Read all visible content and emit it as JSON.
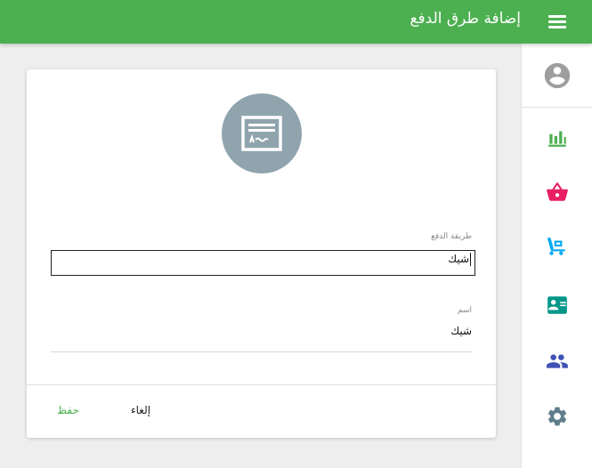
{
  "header": {
    "title": "إضافة طرق الدفع",
    "menu_icon": "menu-icon"
  },
  "sidebar": {
    "items": [
      {
        "name": "profile",
        "icon": "account-circle-icon",
        "color": "#9e9e9e"
      },
      {
        "name": "reports",
        "icon": "bar-chart-icon",
        "color": "#4caf50"
      },
      {
        "name": "sales",
        "icon": "shopping-basket-icon",
        "color": "#e91e63"
      },
      {
        "name": "purchases",
        "icon": "dolly-cart-icon",
        "color": "#03a9f4"
      },
      {
        "name": "contacts",
        "icon": "contact-card-icon",
        "color": "#009688"
      },
      {
        "name": "users",
        "icon": "people-icon",
        "color": "#3f51b5"
      },
      {
        "name": "settings",
        "icon": "gear-icon",
        "color": "#607d8b"
      }
    ]
  },
  "form": {
    "icon": "cheque-icon",
    "payment_method": {
      "label": "طريقة الدفع",
      "value": "شيك"
    },
    "name": {
      "label": "اسم",
      "value": "شيك"
    },
    "save_label": "حفظ",
    "cancel_label": "إلغاء"
  },
  "colors": {
    "primary": "#4caf50",
    "avatar_bg": "#90a4ae",
    "background": "#eeeeee"
  }
}
